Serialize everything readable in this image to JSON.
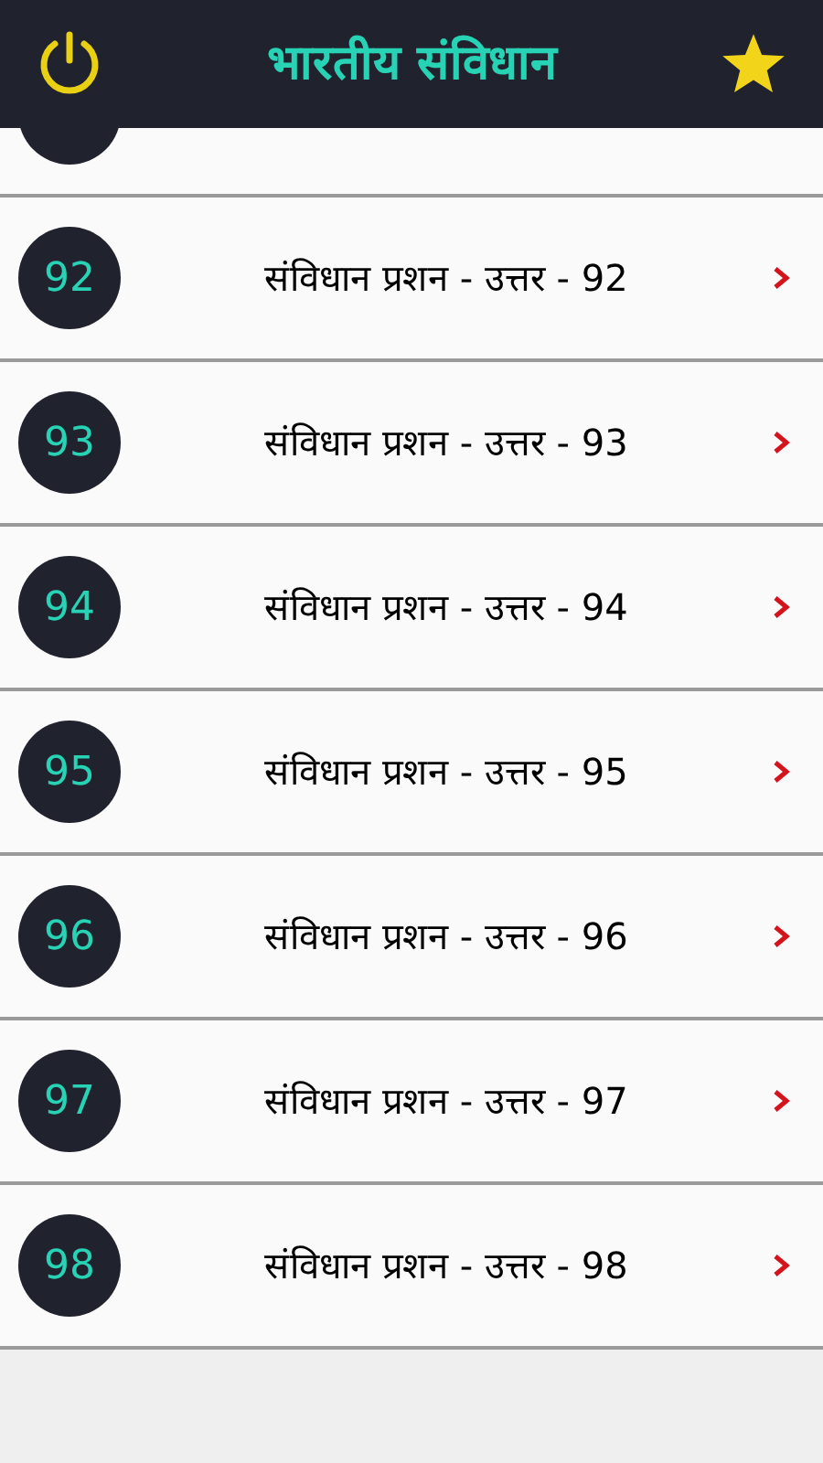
{
  "header": {
    "title": "भारतीय संविधान"
  },
  "rows": [
    {
      "number": "92",
      "label": "संविधान प्रशन - उत्तर - 92"
    },
    {
      "number": "93",
      "label": "संविधान प्रशन - उत्तर - 93"
    },
    {
      "number": "94",
      "label": "संविधान प्रशन - उत्तर - 94"
    },
    {
      "number": "95",
      "label": "संविधान प्रशन - उत्तर - 95"
    },
    {
      "number": "96",
      "label": "संविधान प्रशन - उत्तर - 96"
    },
    {
      "number": "97",
      "label": "संविधान प्रशन - उत्तर - 97"
    },
    {
      "number": "98",
      "label": "संविधान प्रशन - उत्तर - 98"
    }
  ]
}
